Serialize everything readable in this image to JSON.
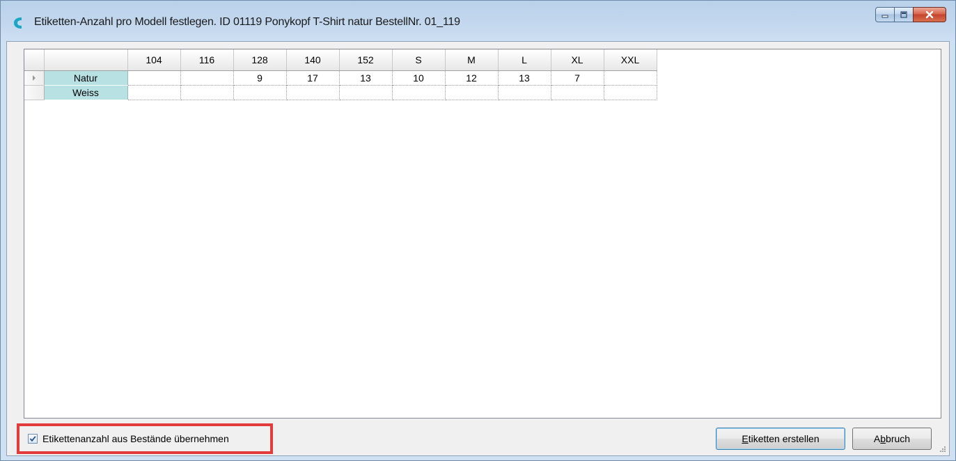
{
  "window": {
    "title": "Etiketten-Anzahl pro Modell festlegen. ID 01119   Ponykopf T-Shirt natur BestellNr. 01_119",
    "icon": "app-c-logo-icon",
    "caption_buttons": [
      "minimize-icon",
      "maximize-icon",
      "close-icon"
    ]
  },
  "grid": {
    "columns": [
      "104",
      "116",
      "128",
      "140",
      "152",
      "S",
      "M",
      "L",
      "XL",
      "XXL"
    ],
    "rows": [
      {
        "label": "Natur",
        "current": true,
        "values": [
          "",
          "",
          "9",
          "17",
          "13",
          "10",
          "12",
          "13",
          "7",
          ""
        ]
      },
      {
        "label": "Weiss",
        "current": false,
        "values": [
          "",
          "",
          "",
          "",
          "",
          "",
          "",
          "",
          "",
          ""
        ]
      }
    ],
    "row_header_color": "#b8e1e4"
  },
  "footer": {
    "checkbox": {
      "label": "Etikettenanzahl aus Bestände übernehmen",
      "checked": true
    },
    "highlight_color": "#e23c3c",
    "create_button": {
      "mnemonic": "E",
      "rest": "tiketten erstellen"
    },
    "cancel_button": {
      "pre": "A",
      "mnemonic": "b",
      "rest": "bruch"
    }
  }
}
